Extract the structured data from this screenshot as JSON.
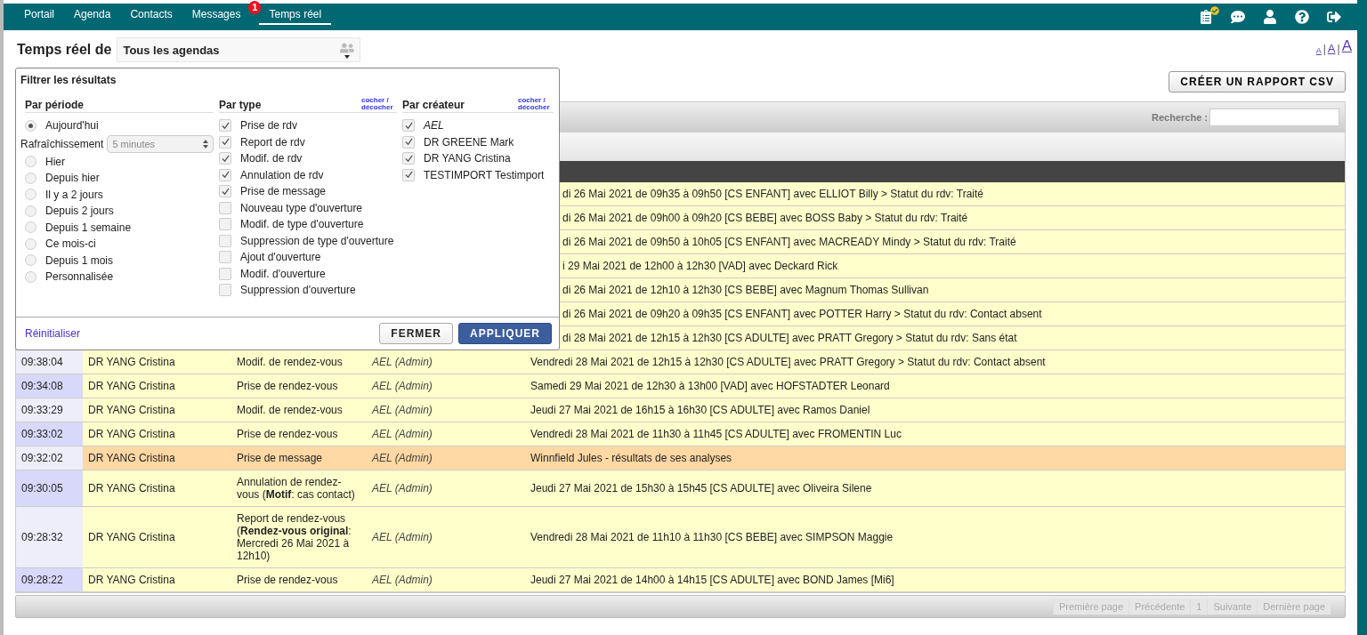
{
  "nav": {
    "tabs": [
      {
        "label": "Portail",
        "selected": false
      },
      {
        "label": "Agenda",
        "selected": false
      },
      {
        "label": "Contacts",
        "selected": false
      },
      {
        "label": "Messages",
        "selected": false,
        "badge": "1"
      },
      {
        "label": "Temps réel",
        "selected": true
      }
    ]
  },
  "header": {
    "title": "Temps réel de",
    "agenda_select": {
      "value": "Tous les agendas"
    },
    "font_size_links": [
      {
        "kind": "link",
        "text": "A"
      },
      {
        "kind": "separator",
        "text": "|"
      },
      {
        "kind": "link",
        "text": "A"
      },
      {
        "kind": "separator",
        "text": "|"
      },
      {
        "kind": "link",
        "text": "A"
      }
    ]
  },
  "csv_button": "CRÉER UN RAPPORT CSV",
  "filter": {
    "title": "Filtrer les résultats",
    "period": {
      "heading": "Par période",
      "options": [
        {
          "label": "Aujourd'hui",
          "selected": true
        },
        {
          "label": "Hier",
          "selected": false
        },
        {
          "label": "Depuis hier",
          "selected": false
        },
        {
          "label": "Il y a 2 jours",
          "selected": false
        },
        {
          "label": "Depuis 2 jours",
          "selected": false
        },
        {
          "label": "Depuis 1 semaine",
          "selected": false
        },
        {
          "label": "Ce mois-ci",
          "selected": false
        },
        {
          "label": "Depuis 1 mois",
          "selected": false
        },
        {
          "label": "Personnalisée",
          "selected": false
        }
      ],
      "refresh": {
        "label": "Rafraîchissement",
        "value": "5 minutes"
      }
    },
    "types": {
      "heading": "Par type",
      "toggle": "cocher / décocher",
      "items": [
        {
          "label": "Prise de rdv",
          "checked": true
        },
        {
          "label": "Report de rdv",
          "checked": true
        },
        {
          "label": "Modif. de rdv",
          "checked": true
        },
        {
          "label": "Annulation de rdv",
          "checked": true
        },
        {
          "label": "Prise de message",
          "checked": true
        },
        {
          "label": "Nouveau type d'ouverture",
          "checked": false
        },
        {
          "label": "Modif. de type d'ouverture",
          "checked": false
        },
        {
          "label": "Suppression de type d'ouverture",
          "checked": false
        },
        {
          "label": "Ajout d'ouverture",
          "checked": false
        },
        {
          "label": "Modif. d'ouverture",
          "checked": false
        },
        {
          "label": "Suppression d'ouverture",
          "checked": false
        }
      ]
    },
    "creators": {
      "heading": "Par créateur",
      "toggle": "cocher / décocher",
      "items": [
        {
          "label": "AEL",
          "checked": true,
          "italic": true
        },
        {
          "label": "DR GREENE Mark",
          "checked": true,
          "italic": false
        },
        {
          "label": "DR YANG Cristina",
          "checked": true,
          "italic": false
        },
        {
          "label": "TESTIMPORT Testimport",
          "checked": true,
          "italic": false
        }
      ]
    },
    "reset": "Réinitialiser",
    "buttons": [
      {
        "kind": "secondary",
        "label": "FERMER"
      },
      {
        "kind": "primary",
        "label": "APPLIQUER"
      }
    ]
  },
  "table": {
    "search_label": "Recherche :",
    "rows": [
      {
        "detail": "di 26 Mai 2021 de 09h35 à 09h50 [CS ENFANT] avec ELLIOT Billy > Statut du rdv: Traité",
        "color": "#ffffcc"
      },
      {
        "detail": "di 26 Mai 2021 de 09h00 à 09h20 [CS BEBE] avec BOSS Baby > Statut du rdv: Traité",
        "color": "#ffffcc"
      },
      {
        "detail": "di 26 Mai 2021 de 09h50 à 10h05 [CS ENFANT] avec MACREADY Mindy > Statut du rdv: Traité",
        "color": "#ffffcc"
      },
      {
        "detail": "i 29 Mai 2021 de 12h00 à 12h30 [VAD] avec Deckard Rick",
        "color": "#ffffcc"
      },
      {
        "detail": "di 26 Mai 2021 de 12h10 à 12h30 [CS BEBE] avec Magnum Thomas Sullivan",
        "color": "#ffffcc"
      },
      {
        "detail": "di 26 Mai 2021 de 09h20 à 09h35 [CS ENFANT] avec POTTER Harry > Statut du rdv: Contact absent",
        "color": "#ffffcc"
      },
      {
        "detail": "di 28 Mai 2021 de 12h15 à 12h30 [CS ADULTE] avec PRATT Gregory > Statut du rdv: Sans état",
        "color": "#ffffcc"
      },
      {
        "time": "09:38:04",
        "agenda": "DR YANG Cristina",
        "type": "Modif. de rendez-vous",
        "creator": "AEL (Admin)",
        "detail": "Vendredi 28 Mai 2021 de 12h15 à 12h30 [CS ADULTE] avec PRATT Gregory > Statut du rdv: Contact absent",
        "color": "#ffffcc"
      },
      {
        "time": "09:34:08",
        "agenda": "DR YANG Cristina",
        "type": "Prise de rendez-vous",
        "creator": "AEL (Admin)",
        "detail": "Samedi 29 Mai 2021 de 12h30 à 13h00 [VAD] avec HOFSTADTER Leonard",
        "color": "#ffffcc"
      },
      {
        "time": "09:33:29",
        "agenda": "DR YANG Cristina",
        "type": "Modif. de rendez-vous",
        "creator": "AEL (Admin)",
        "detail": "Jeudi 27 Mai 2021 de 16h15 à 16h30 [CS ADULTE] avec Ramos Daniel",
        "color": "#ffffcc"
      },
      {
        "time": "09:33:02",
        "agenda": "DR YANG Cristina",
        "type": "Prise de rendez-vous",
        "creator": "AEL (Admin)",
        "detail": "Vendredi 28 Mai 2021 de 11h30 à 11h45 [CS ADULTE] avec FROMENTIN Luc",
        "color": "#ffffcc"
      },
      {
        "time": "09:32:02",
        "agenda": "DR YANG Cristina",
        "type": "Prise de message",
        "creator": "AEL (Admin)",
        "detail": "Winnfield Jules - résultats de ses analyses",
        "color": "#ffd8a4"
      },
      {
        "time": "09:30:05",
        "agenda": "DR YANG Cristina",
        "type": "Annulation de rendez-vous (**Motif**: cas contact)",
        "creator": "AEL (Admin)",
        "detail": "Jeudi 27 Mai 2021 de 15h30 à 15h45 [CS ADULTE] avec Oliveira Silene",
        "color": "#ffffcc"
      },
      {
        "time": "09:28:32",
        "agenda": "DR YANG Cristina",
        "type": "Report de rendez-vous (**Rendez-vous original**: Mercredi 26 Mai 2021 à 12h10)",
        "creator": "AEL (Admin)",
        "detail": "Vendredi 28 Mai 2021 de 11h10 à 11h30 [CS BEBE] avec SIMPSON Maggie",
        "color": "#ffffcc"
      },
      {
        "time": "09:28:22",
        "agenda": "DR YANG Cristina",
        "type": "Prise de rendez-vous",
        "creator": "AEL (Admin)",
        "detail": "Jeudi 27 Mai 2021 de 14h00 à 14h15 [CS ADULTE] avec BOND James [Mi6]",
        "color": "#ffffcc"
      }
    ],
    "pagination": [
      {
        "label": "Première page",
        "disabled": true
      },
      {
        "label": "Précédente",
        "disabled": true
      },
      {
        "label": "1",
        "disabled": true
      },
      {
        "label": "Suivante",
        "disabled": true
      },
      {
        "label": "Dernière page",
        "disabled": true
      }
    ]
  }
}
